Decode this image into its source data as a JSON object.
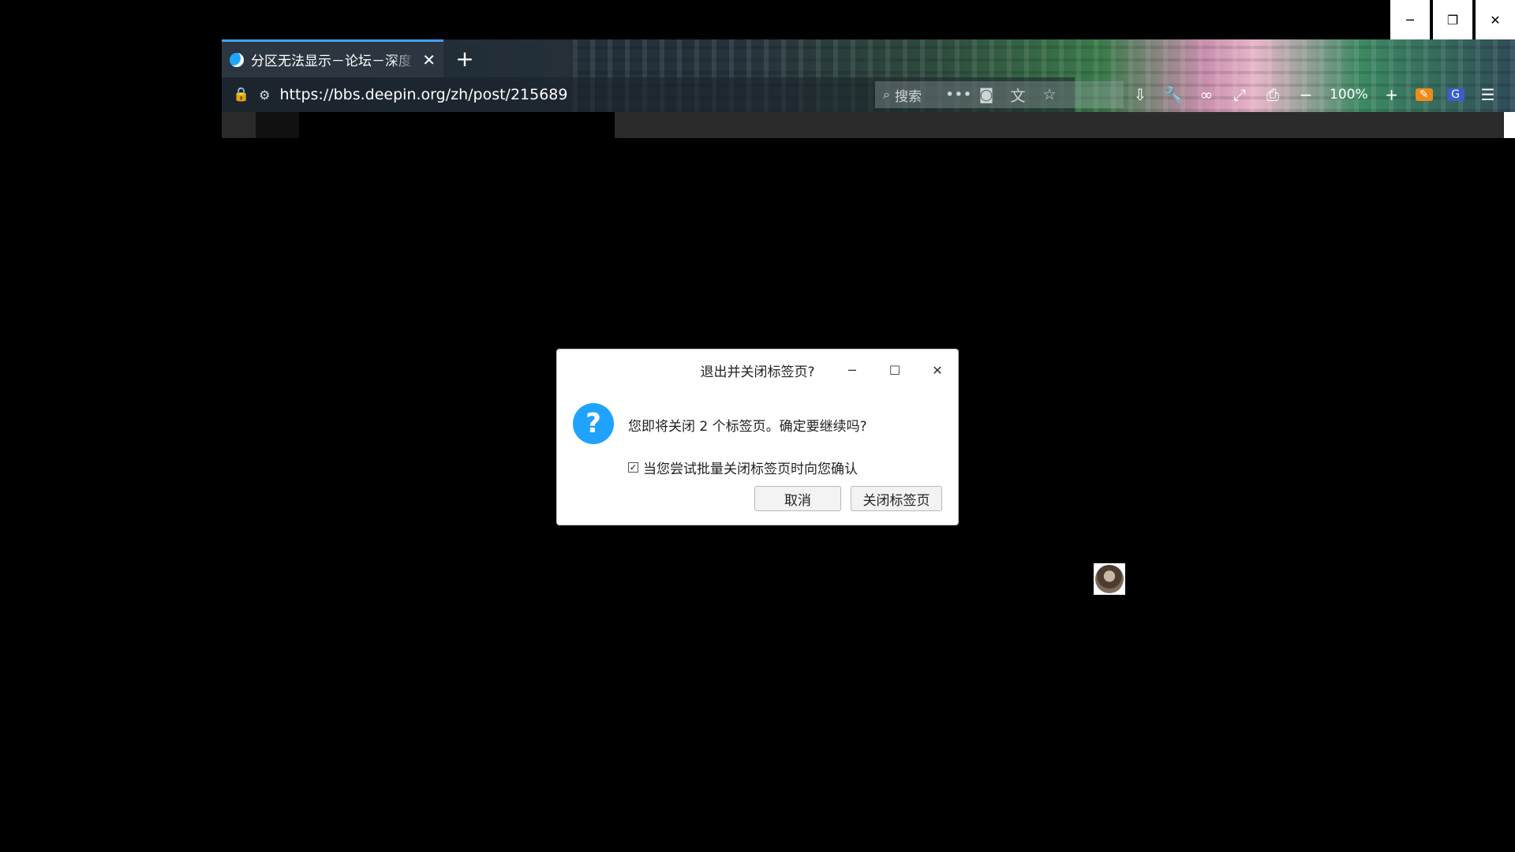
{
  "window_controls": {
    "minimize": "─",
    "restore": "❐",
    "close": "✕"
  },
  "browser": {
    "tab": {
      "title": "分区无法显示－论坛－深度",
      "close": "✕"
    },
    "newtab": "+",
    "url": "https://bbs.deepin.org/zh/post/215689",
    "search_placeholder": "搜索",
    "zoom": "100%",
    "icons": {
      "lock": "lock-icon",
      "permissions": "permissions-icon",
      "more": "more-icon",
      "pocket": "pocket-icon",
      "translate": "translate-icon",
      "bookmark": "star-icon",
      "downloads": "download-icon",
      "tools": "wrench-icon",
      "private": "mask-icon",
      "fullscreen": "fullscreen-icon",
      "print": "print-icon",
      "zoom_out": "minus-icon",
      "zoom_in": "plus-icon",
      "menu": "menu-icon"
    }
  },
  "dialog": {
    "title": "退出并关闭标签页?",
    "message": "您即将关闭 2 个标签页。确定要继续吗?",
    "checkbox_label": "当您尝试批量关闭标签页时向您确认",
    "checkbox_checked": true,
    "cancel_label": "取消",
    "confirm_label": "关闭标签页",
    "icon_color": "#1fa3ff"
  }
}
